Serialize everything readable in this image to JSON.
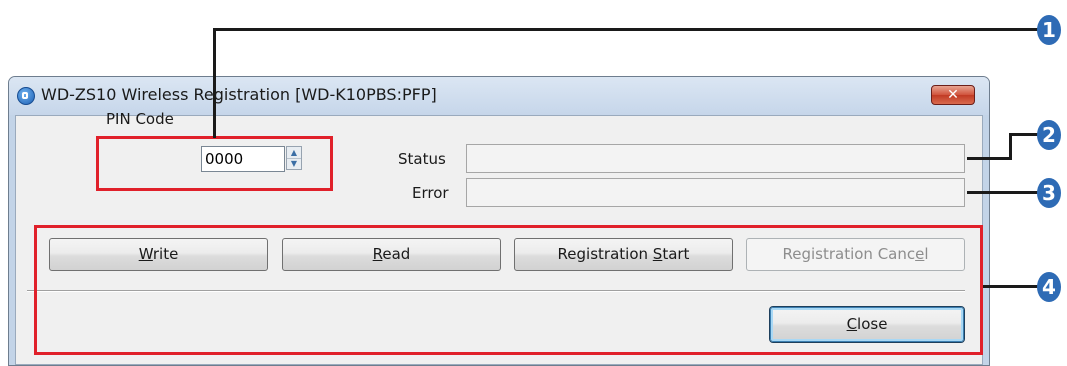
{
  "window": {
    "title": "WD-ZS10 Wireless Registration [WD-K10PBS:PFP]",
    "close_glyph": "✕"
  },
  "form": {
    "pin_label": "PIN Code",
    "pin_value": "0000",
    "status_label": "Status",
    "status_value": "",
    "error_label": "Error",
    "error_value": ""
  },
  "buttons": {
    "write": {
      "mnemonic_before": "",
      "mnemonic": "W",
      "mnemonic_after": "rite"
    },
    "read": {
      "mnemonic_before": "",
      "mnemonic": "R",
      "mnemonic_after": "ead"
    },
    "registration_start": {
      "mnemonic_before": "Registration ",
      "mnemonic": "S",
      "mnemonic_after": "tart"
    },
    "registration_cancel": {
      "mnemonic_before": "Registration Canc",
      "mnemonic": "e",
      "mnemonic_after": "l"
    },
    "close": {
      "mnemonic_before": "",
      "mnemonic": "C",
      "mnemonic_after": "lose"
    }
  },
  "callouts": [
    "1",
    "2",
    "3",
    "4"
  ],
  "colors": {
    "highlight": "#e0202a",
    "marker": "#2e6bb5",
    "close_button": "#c13a24"
  }
}
